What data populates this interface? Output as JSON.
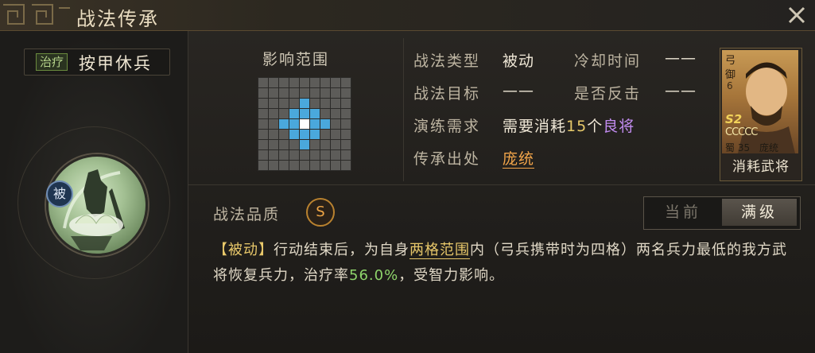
{
  "window": {
    "title": "战法传承"
  },
  "skill": {
    "tag": "治疗",
    "name": "按甲休兵",
    "passive_badge": "被"
  },
  "range": {
    "label": "影响范围",
    "grid_size": 9,
    "blue_cells": [
      [
        3,
        4
      ],
      [
        4,
        3
      ],
      [
        4,
        5
      ],
      [
        5,
        4
      ],
      [
        2,
        4
      ],
      [
        4,
        2
      ],
      [
        4,
        6
      ],
      [
        6,
        4
      ],
      [
        3,
        3
      ],
      [
        3,
        5
      ],
      [
        5,
        3
      ],
      [
        5,
        5
      ]
    ],
    "center_cell": [
      4,
      4
    ]
  },
  "info": {
    "type_label": "战法类型",
    "type_value": "被动",
    "cooldown_label": "冷却时间",
    "cooldown_value": "——",
    "target_label": "战法目标",
    "target_value": "——",
    "counter_label": "是否反击",
    "counter_value": "——",
    "training_label": "演练需求",
    "training_prefix": "需要消耗",
    "training_num": "15",
    "training_mid": "个",
    "training_quality": "良将",
    "source_label": "传承出处",
    "source_value": "庞统"
  },
  "card": {
    "troop": "弓",
    "yu": "御",
    "yu_num": "6",
    "season": "S2",
    "stars": "CCCCC",
    "faction": "蜀",
    "cost": "35",
    "general_name": "庞统",
    "caption": "消耗武将"
  },
  "quality": {
    "label": "战法品质",
    "grade": "S"
  },
  "toggle": {
    "current": "当前",
    "max": "满级"
  },
  "description": {
    "bracket": "【被动】",
    "part1": "行动结束后，为自身",
    "range_link": "两格范围",
    "part2": "内（弓兵携带时为四格）两名兵力最低的我方武将恢复兵力，治疗率",
    "rate": "56.0%",
    "part3": "，受智力影响。"
  },
  "colors": {
    "accent": "#f2a54a",
    "range_blue": "#4aa8dc",
    "quality_purple": "#c28cf0"
  }
}
